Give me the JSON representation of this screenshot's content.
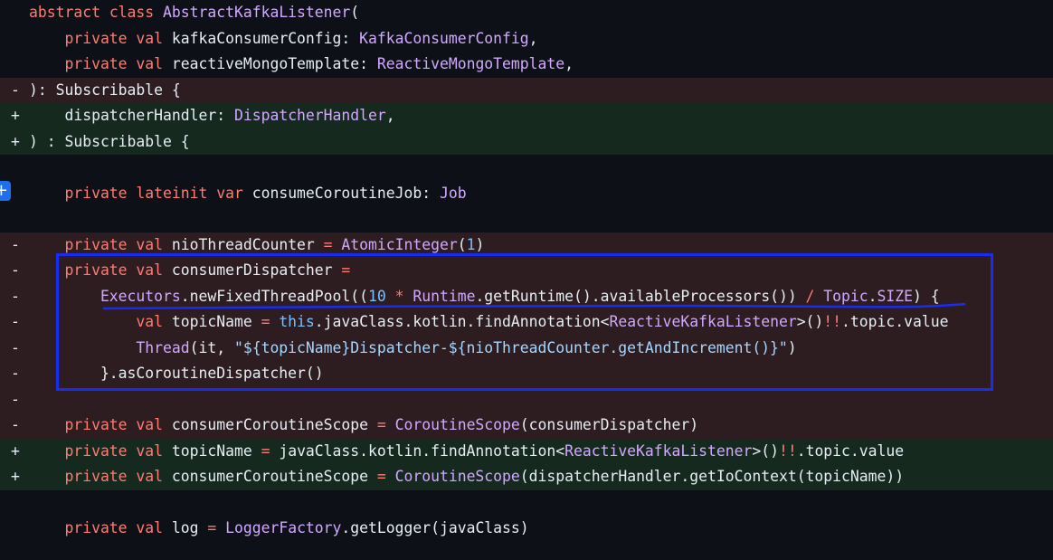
{
  "diff_lines": [
    {
      "type": "empty",
      "marker": "",
      "tokens": [
        {
          "t": "abstract ",
          "c": "kw"
        },
        {
          "t": "class ",
          "c": "kw"
        },
        {
          "t": "AbstractKafkaListener",
          "c": "ty"
        },
        {
          "t": "(",
          "c": "pl"
        }
      ]
    },
    {
      "type": "empty",
      "marker": "",
      "tokens": [
        {
          "t": "    private ",
          "c": "kw"
        },
        {
          "t": "val ",
          "c": "kw"
        },
        {
          "t": "kafkaConsumerConfig",
          "c": "pl"
        },
        {
          "t": ": ",
          "c": "pl"
        },
        {
          "t": "KafkaConsumerConfig",
          "c": "ty"
        },
        {
          "t": ",",
          "c": "pl"
        }
      ]
    },
    {
      "type": "empty",
      "marker": "",
      "tokens": [
        {
          "t": "    private ",
          "c": "kw"
        },
        {
          "t": "val ",
          "c": "kw"
        },
        {
          "t": "reactiveMongoTemplate",
          "c": "pl"
        },
        {
          "t": ": ",
          "c": "pl"
        },
        {
          "t": "ReactiveMongoTemplate",
          "c": "ty"
        },
        {
          "t": ",",
          "c": "pl"
        }
      ]
    },
    {
      "type": "del",
      "marker": "-",
      "tokens": [
        {
          "t": "): Subscribable {",
          "c": "pl"
        }
      ]
    },
    {
      "type": "add",
      "marker": "+",
      "tokens": [
        {
          "t": "    dispatcherHandler",
          "c": "pl"
        },
        {
          "t": ": ",
          "c": "pl"
        },
        {
          "t": "DispatcherHandler",
          "c": "ty"
        },
        {
          "t": ",",
          "c": "pl"
        }
      ]
    },
    {
      "type": "add",
      "marker": "+",
      "tokens": [
        {
          "t": ") : Subscribable {",
          "c": "pl"
        }
      ]
    },
    {
      "type": "empty",
      "marker": "",
      "tokens": []
    },
    {
      "type": "empty",
      "marker": "",
      "tokens": [
        {
          "t": "    private ",
          "c": "kw"
        },
        {
          "t": "lateinit ",
          "c": "kw"
        },
        {
          "t": "var ",
          "c": "kw"
        },
        {
          "t": "consumeCoroutineJob",
          "c": "pl"
        },
        {
          "t": ": ",
          "c": "pl"
        },
        {
          "t": "Job",
          "c": "ty"
        }
      ]
    },
    {
      "type": "empty",
      "marker": "",
      "tokens": []
    },
    {
      "type": "del",
      "marker": "-",
      "tokens": [
        {
          "t": "    private ",
          "c": "kw"
        },
        {
          "t": "val ",
          "c": "kw"
        },
        {
          "t": "nioThreadCounter",
          "c": "pl"
        },
        {
          "t": " = ",
          "c": "kw"
        },
        {
          "t": "AtomicInteger",
          "c": "ty"
        },
        {
          "t": "(",
          "c": "pl"
        },
        {
          "t": "1",
          "c": "nm"
        },
        {
          "t": ")",
          "c": "pl"
        }
      ]
    },
    {
      "type": "del",
      "marker": "-",
      "tokens": [
        {
          "t": "    private ",
          "c": "kw"
        },
        {
          "t": "val ",
          "c": "kw"
        },
        {
          "t": "consumerDispatcher",
          "c": "pl"
        },
        {
          "t": " =",
          "c": "kw"
        }
      ]
    },
    {
      "type": "del",
      "marker": "-",
      "tokens": [
        {
          "t": "        Executors",
          "c": "ty"
        },
        {
          "t": ".newFixedThreadPool((",
          "c": "pl"
        },
        {
          "t": "10",
          "c": "nm"
        },
        {
          "t": " * ",
          "c": "kw"
        },
        {
          "t": "Runtime",
          "c": "ty"
        },
        {
          "t": ".getRuntime().availableProcessors())",
          "c": "pl"
        },
        {
          "t": " / ",
          "c": "kw"
        },
        {
          "t": "Topic",
          "c": "ty"
        },
        {
          "t": ".",
          "c": "pl"
        },
        {
          "t": "SIZE",
          "c": "ty"
        },
        {
          "t": ") {",
          "c": "pl"
        }
      ]
    },
    {
      "type": "del",
      "marker": "-",
      "tokens": [
        {
          "t": "            val ",
          "c": "kw"
        },
        {
          "t": "topicName",
          "c": "pl"
        },
        {
          "t": " = ",
          "c": "kw"
        },
        {
          "t": "this",
          "c": "nm"
        },
        {
          "t": ".javaClass.kotlin.findAnnotation<",
          "c": "pl"
        },
        {
          "t": "ReactiveKafkaListener",
          "c": "ty"
        },
        {
          "t": ">()",
          "c": "pl"
        },
        {
          "t": "!!",
          "c": "kw"
        },
        {
          "t": ".topic.value",
          "c": "pl"
        }
      ]
    },
    {
      "type": "del",
      "marker": "-",
      "tokens": [
        {
          "t": "            Thread",
          "c": "ty"
        },
        {
          "t": "(it, ",
          "c": "pl"
        },
        {
          "t": "\"${topicName}Dispatcher-${nioThreadCounter.getAndIncrement()}\"",
          "c": "st"
        },
        {
          "t": ")",
          "c": "pl"
        }
      ]
    },
    {
      "type": "del",
      "marker": "-",
      "tokens": [
        {
          "t": "        }.asCoroutineDispatcher()",
          "c": "pl"
        }
      ]
    },
    {
      "type": "del",
      "marker": "-",
      "tokens": []
    },
    {
      "type": "del",
      "marker": "-",
      "tokens": [
        {
          "t": "    private ",
          "c": "kw"
        },
        {
          "t": "val ",
          "c": "kw"
        },
        {
          "t": "consumerCoroutineScope",
          "c": "pl"
        },
        {
          "t": " = ",
          "c": "kw"
        },
        {
          "t": "CoroutineScope",
          "c": "ty"
        },
        {
          "t": "(consumerDispatcher)",
          "c": "pl"
        }
      ]
    },
    {
      "type": "add",
      "marker": "+",
      "tokens": [
        {
          "t": "    private ",
          "c": "kw"
        },
        {
          "t": "val ",
          "c": "kw"
        },
        {
          "t": "topicName",
          "c": "pl"
        },
        {
          "t": " = ",
          "c": "kw"
        },
        {
          "t": "javaClass.kotlin.findAnnotation<",
          "c": "pl"
        },
        {
          "t": "ReactiveKafkaListener",
          "c": "ty"
        },
        {
          "t": ">()",
          "c": "pl"
        },
        {
          "t": "!!",
          "c": "kw"
        },
        {
          "t": ".topic.value",
          "c": "pl"
        }
      ]
    },
    {
      "type": "add",
      "marker": "+",
      "tokens": [
        {
          "t": "    private ",
          "c": "kw"
        },
        {
          "t": "val ",
          "c": "kw"
        },
        {
          "t": "consumerCoroutineScope",
          "c": "pl"
        },
        {
          "t": " = ",
          "c": "kw"
        },
        {
          "t": "CoroutineScope",
          "c": "ty"
        },
        {
          "t": "(dispatcherHandler.getIoContext(topicName))",
          "c": "pl"
        }
      ]
    },
    {
      "type": "empty",
      "marker": "",
      "tokens": []
    },
    {
      "type": "empty",
      "marker": "",
      "tokens": [
        {
          "t": "    private ",
          "c": "kw"
        },
        {
          "t": "val ",
          "c": "kw"
        },
        {
          "t": "log",
          "c": "pl"
        },
        {
          "t": " = ",
          "c": "kw"
        },
        {
          "t": "LoggerFactory",
          "c": "ty"
        },
        {
          "t": ".getLogger(javaClass)",
          "c": "pl"
        }
      ]
    }
  ],
  "expand_button": {
    "icon": "plus-icon",
    "label": "+"
  },
  "colors": {
    "background": "#0d1117",
    "deleted_line_bg": "#2d1d20",
    "added_line_bg": "#15291f",
    "keyword": "#ff7b72",
    "type": "#d2a8ff",
    "number": "#79c0ff",
    "string": "#a5d6ff",
    "annotation": "#1a2cf0"
  }
}
